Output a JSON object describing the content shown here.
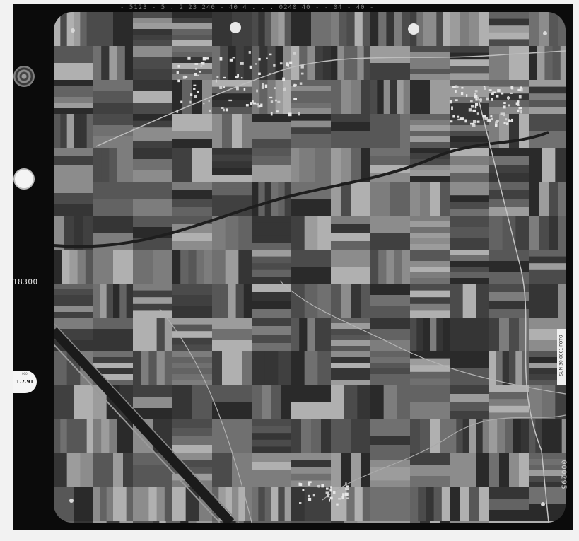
{
  "image": {
    "kind": "aerial photograph",
    "colors": {
      "frame": "#0b0b0b",
      "background": "#f2f2f2",
      "photo_tone": "#4a4a4a"
    }
  },
  "margin_text": {
    "top_header": "- 5123 - 5 . 2 23   240 - 40    4 . . .    0240 40 -  - 04 - 40 -",
    "flight_counter": "18300",
    "date_label": "1.7.91",
    "date_small": "000",
    "side_label": "SUN-30-0001 FOTO",
    "frame_number": "000295"
  },
  "icons": {
    "altimeter": "altimeter-gauge-icon",
    "clock": "clock-icon",
    "fiducials": "fiducial-mark-icon"
  }
}
